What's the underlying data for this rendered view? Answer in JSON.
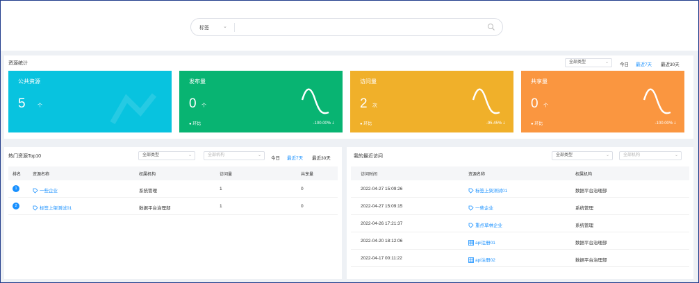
{
  "search": {
    "select_value": "标签",
    "placeholder": ""
  },
  "stats": {
    "title": "资源统计",
    "type_filter": "全部类型",
    "ranges": [
      "今日",
      "最近7天",
      "最近30天"
    ],
    "active_range": 1,
    "cards": [
      {
        "title": "公共资源",
        "value": "5",
        "unit": "个",
        "color": "#08c3df"
      },
      {
        "title": "发布量",
        "value": "0",
        "unit": "个",
        "compare_label": "环比",
        "compare_value": "-100.00%",
        "color": "#08b472"
      },
      {
        "title": "访问量",
        "value": "2",
        "unit": "次",
        "compare_label": "环比",
        "compare_value": "-95.45%",
        "color": "#f0b02a"
      },
      {
        "title": "共享量",
        "value": "0",
        "unit": "个",
        "compare_label": "环比",
        "compare_value": "-100.00%",
        "color": "#fa9640"
      }
    ]
  },
  "top10": {
    "title": "热门资源Top10",
    "type_filter": "全部类型",
    "org_placeholder": "全部机构",
    "ranges": [
      "今日",
      "最近7天",
      "最近30天"
    ],
    "active_range": 1,
    "columns": [
      "排名",
      "资源名称",
      "权属机构",
      "访问量",
      "共享量"
    ],
    "rows": [
      {
        "rank": "1",
        "name": "一些企业",
        "org": "系统管理",
        "visits": "1",
        "shares": "0"
      },
      {
        "rank": "2",
        "name": "标签上架测试01",
        "org": "数据平台治理部",
        "visits": "1",
        "shares": "0"
      }
    ]
  },
  "recent": {
    "title": "我的最近访问",
    "type_filter": "全部类型",
    "org_placeholder": "全部机构",
    "columns": [
      "访问时间",
      "资源名称",
      "权属机构"
    ],
    "rows": [
      {
        "time": "2022-04-27 15:09:26",
        "name": "标签上架测试01",
        "org": "数据平台治理部",
        "icon": "tag-icon"
      },
      {
        "time": "2022-04-27 15:09:15",
        "name": "一些企业",
        "org": "系统管理",
        "icon": "tag-icon"
      },
      {
        "time": "2022-04-26 17:21:37",
        "name": "重点草林企业",
        "org": "系统管理",
        "icon": "tag-icon"
      },
      {
        "time": "2022-04-20 18:12:06",
        "name": "api注册01",
        "org": "数据平台治理部",
        "icon": "table-icon"
      },
      {
        "time": "2022-04-17 00:11:22",
        "name": "api注册02",
        "org": "数据平台治理部",
        "icon": "table-icon"
      }
    ]
  }
}
